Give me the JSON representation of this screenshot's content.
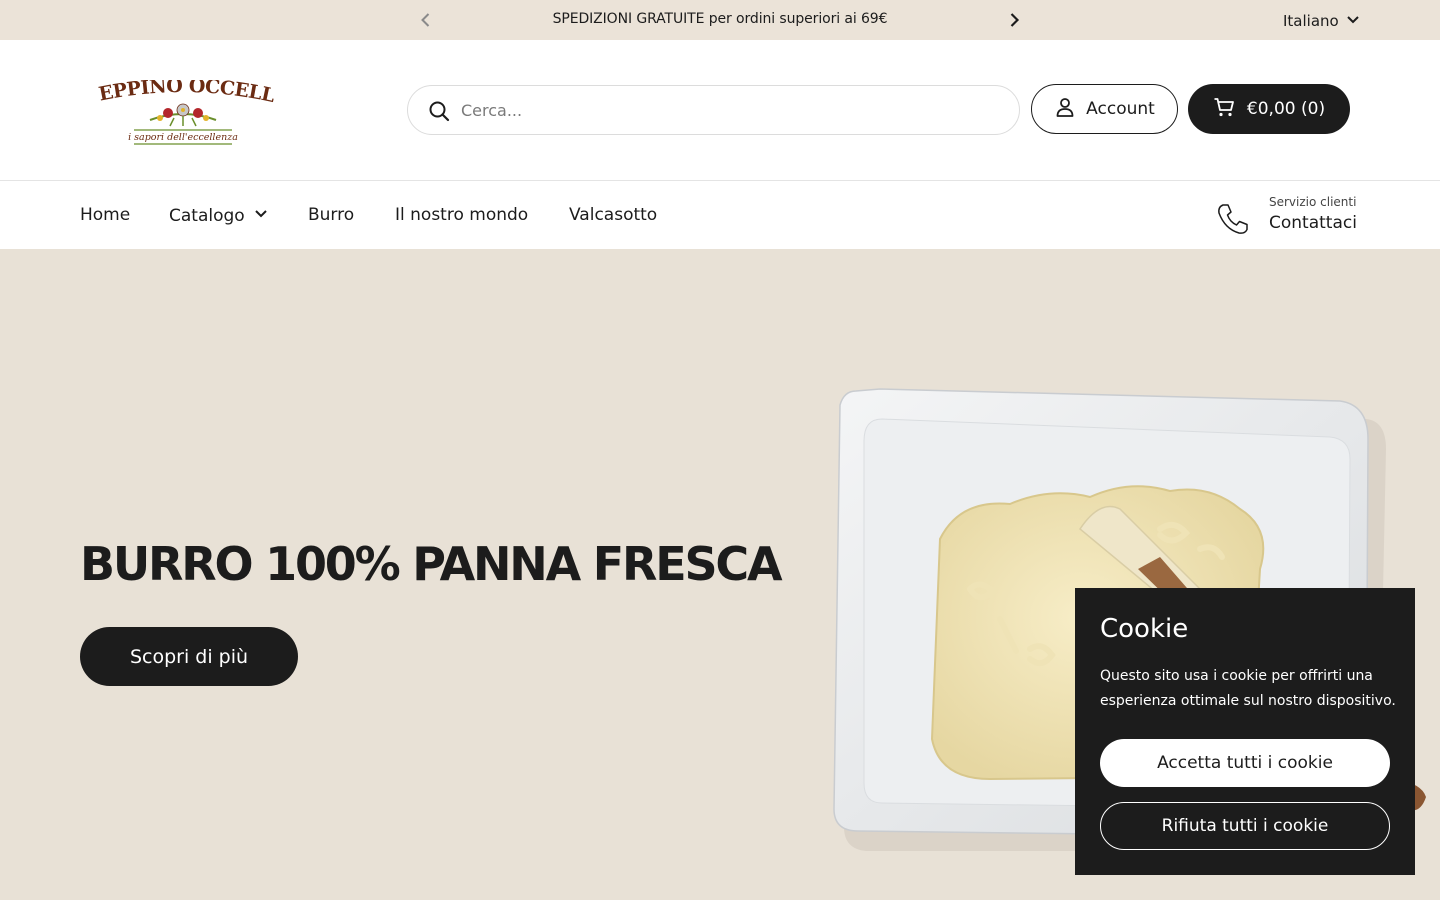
{
  "announcement": {
    "message": "SPEDIZIONI GRATUITE per ordini superiori ai 69€",
    "language": "Italiano"
  },
  "header": {
    "logo": {
      "brand": "BEPPINO OCCELLI",
      "tagline": "i sapori dell'eccellenza"
    },
    "search": {
      "placeholder": "Cerca..."
    },
    "account_label": "Account",
    "cart_label": "€0,00 (0)"
  },
  "nav": {
    "items": [
      {
        "label": "Home"
      },
      {
        "label": "Catalogo"
      },
      {
        "label": "Burro"
      },
      {
        "label": "Il nostro mondo"
      },
      {
        "label": "Valcasotto"
      }
    ],
    "contact": {
      "small": "Servizio clienti",
      "label": "Contattaci"
    }
  },
  "hero": {
    "title": "BURRO 100% PANNA FRESCA",
    "button_label": "Scopri di più"
  },
  "cookie": {
    "title": "Cookie",
    "text": "Questo sito usa i cookie per offrirti una esperienza ottimale sul nostro dispositivo.",
    "accept_label": "Accetta tutti i cookie",
    "reject_label": "Rifiuta tutti i cookie"
  },
  "colors": {
    "accent_dark": "#1c1c1c",
    "hero_bg": "#e8e1d6",
    "announcement_bg": "#ebe3d8",
    "logo_brown": "#6b2b12",
    "logo_green": "#6a8f2c"
  }
}
